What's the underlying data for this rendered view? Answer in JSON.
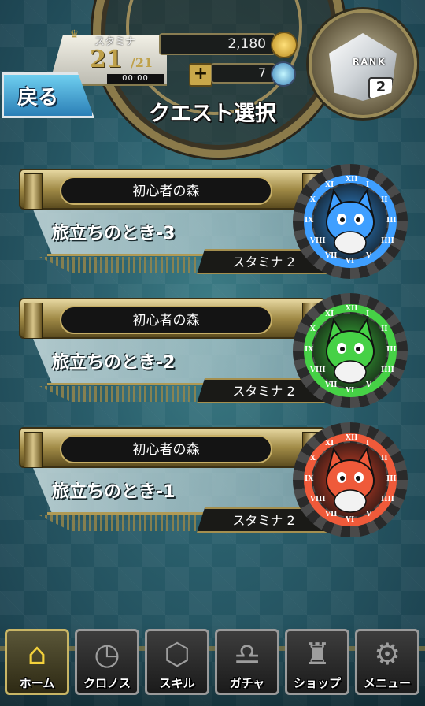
{
  "header": {
    "stamina_label": "スタミナ",
    "stamina_current": "21",
    "stamina_max": "/21",
    "stamina_timer": "00:00",
    "coins": "2,180",
    "gems": "7",
    "plus_label": "+",
    "rank_label": "RANK",
    "rank_value": "2",
    "back_label": "戻る",
    "title": "クエスト選択"
  },
  "quests": [
    {
      "area": "初心者の森",
      "name": "旅立ちのとき-3",
      "stamina": "スタミナ 2",
      "color": "#2f8de0",
      "ring": "#3f9fff",
      "icon": "blue-cat-icon"
    },
    {
      "area": "初心者の森",
      "name": "旅立ちのとき-2",
      "stamina": "スタミナ 2",
      "color": "#3cc23c",
      "ring": "#46d146",
      "icon": "green-cat-icon"
    },
    {
      "area": "初心者の森",
      "name": "旅立ちのとき-1",
      "stamina": "スタミナ 2",
      "color": "#e2452a",
      "ring": "#ef5a3a",
      "icon": "red-cat-icon"
    }
  ],
  "nav": [
    {
      "label": "ホーム",
      "icon": "home-icon",
      "glyph": "⌂",
      "active": true
    },
    {
      "label": "クロノス",
      "icon": "chronos-clock-icon",
      "glyph": "◷",
      "active": false
    },
    {
      "label": "スキル",
      "icon": "skill-hexagon-icon",
      "glyph": "⬡",
      "active": false
    },
    {
      "label": "ガチャ",
      "icon": "gacha-icon",
      "glyph": "♎",
      "active": false
    },
    {
      "label": "ショップ",
      "icon": "shop-bag-icon",
      "glyph": "♜",
      "active": false
    },
    {
      "label": "メニュー",
      "icon": "gear-icon",
      "glyph": "⚙",
      "active": false
    }
  ]
}
